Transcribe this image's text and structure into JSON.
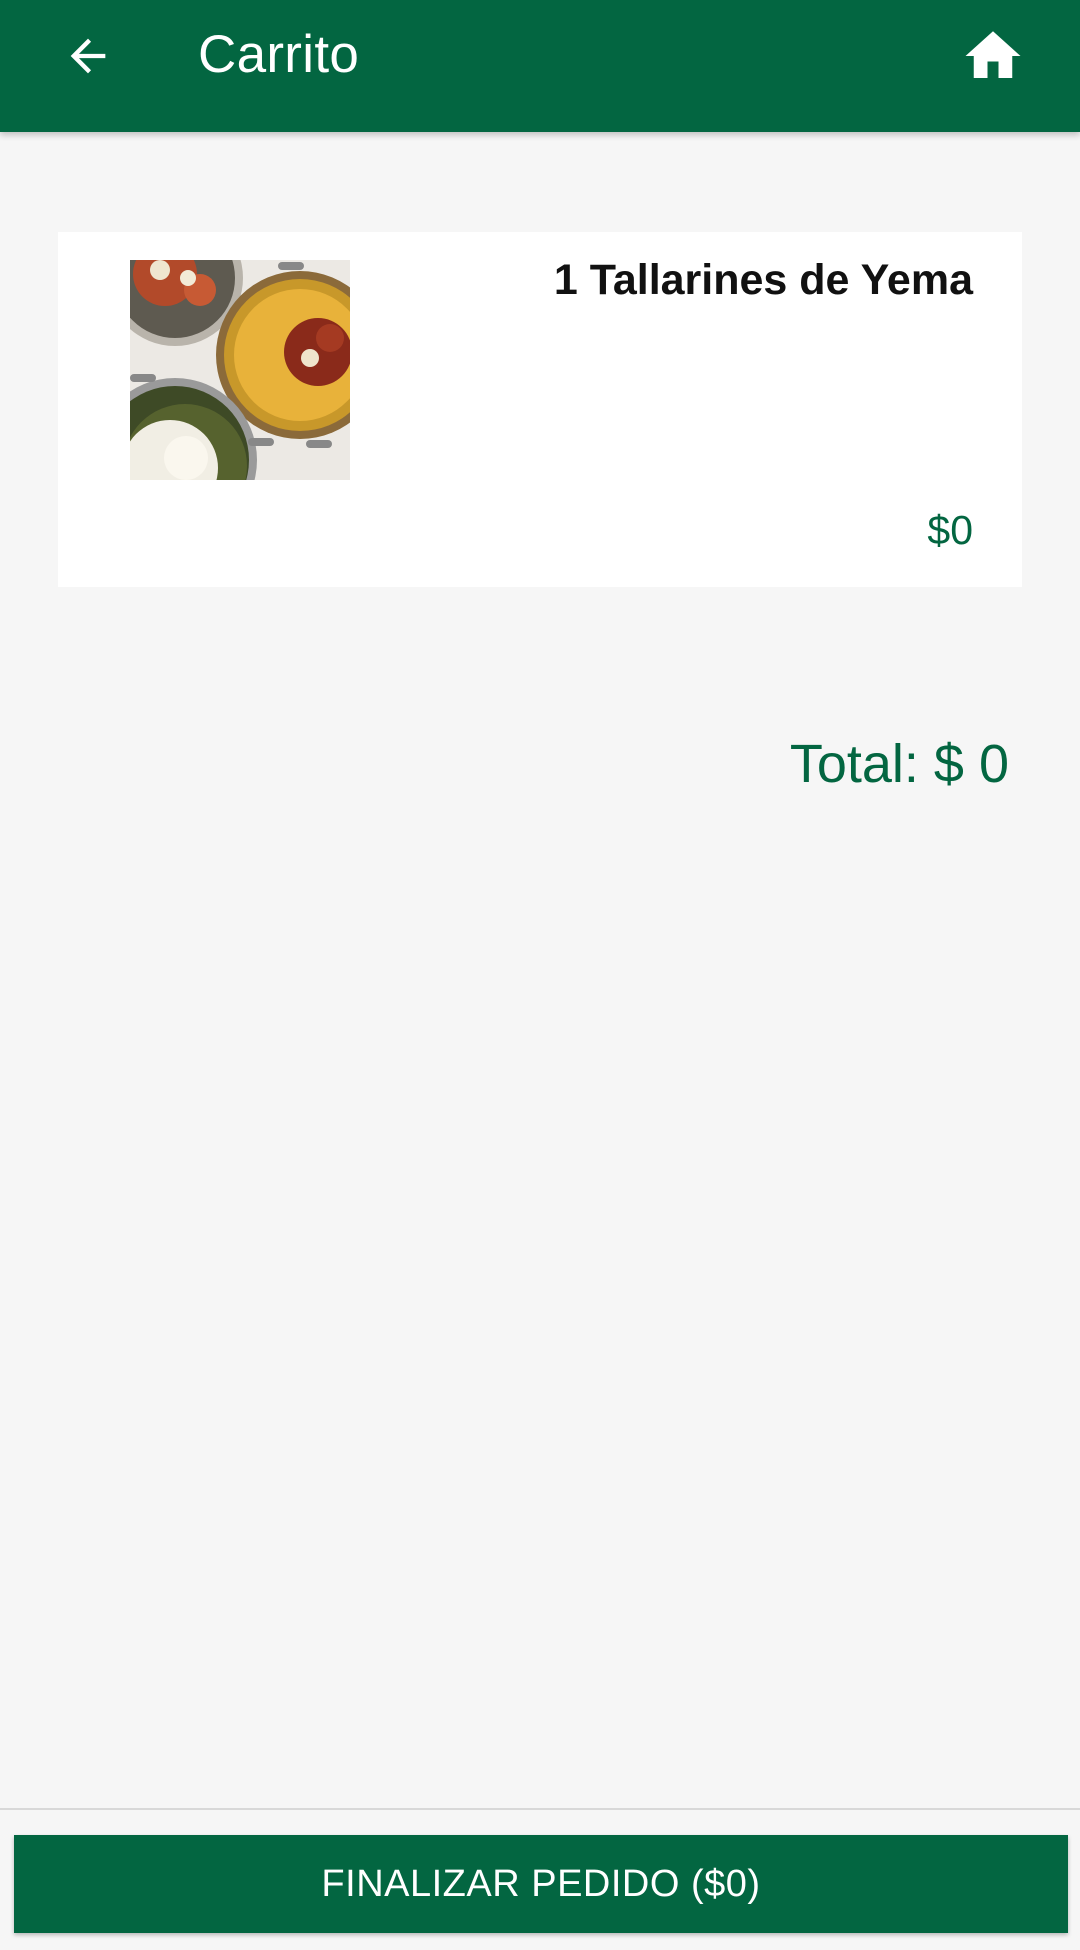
{
  "app_bar": {
    "title": "Carrito",
    "back_icon": "arrow-left-icon",
    "home_icon": "home-icon",
    "background_color": "#036641"
  },
  "cart": {
    "items": [
      {
        "name": "1 Tallarines de Yema",
        "price": "$0",
        "image_icon": "pasta-dish-photo"
      }
    ],
    "total_label": "Total: $ 0"
  },
  "footer": {
    "finalize_label": "FINALIZAR PEDIDO ($0)",
    "button_color": "#036641"
  },
  "colors": {
    "accent": "#036641",
    "background": "#f6f6f6",
    "card": "#ffffff"
  }
}
